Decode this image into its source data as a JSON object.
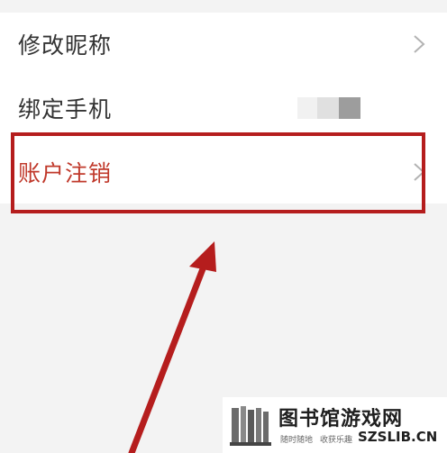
{
  "settings": {
    "items": [
      {
        "label": "修改昵称",
        "icon": "chevron-right-icon"
      },
      {
        "label": "绑定手机",
        "value_masked": true
      },
      {
        "label": "账户注销",
        "icon": "chevron-right-icon",
        "color": "#c0392b"
      }
    ]
  },
  "annotation": {
    "highlight_color": "#b51d1d",
    "arrow_color": "#b51d1d"
  },
  "watermark": {
    "title": "图书馆游戏网",
    "sub_left": "随时随地",
    "sub_right": "收获乐趣",
    "domain": "SZSLIB.CN",
    "logo_icon": "library-logo-icon"
  }
}
